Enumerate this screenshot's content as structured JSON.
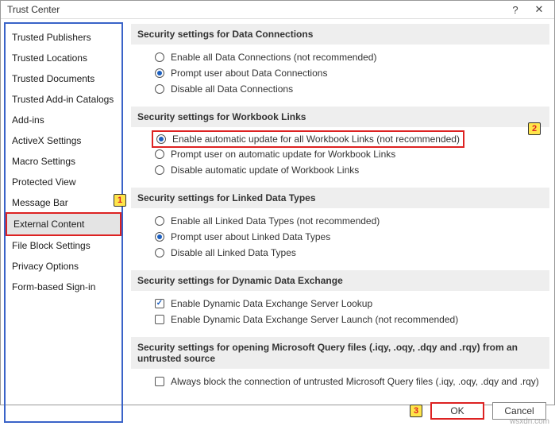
{
  "window": {
    "title": "Trust Center"
  },
  "sidebar": {
    "items": [
      {
        "label": "Trusted Publishers"
      },
      {
        "label": "Trusted Locations"
      },
      {
        "label": "Trusted Documents"
      },
      {
        "label": "Trusted Add-in Catalogs"
      },
      {
        "label": "Add-ins"
      },
      {
        "label": "ActiveX Settings"
      },
      {
        "label": "Macro Settings"
      },
      {
        "label": "Protected View"
      },
      {
        "label": "Message Bar"
      },
      {
        "label": "External Content"
      },
      {
        "label": "File Block Settings"
      },
      {
        "label": "Privacy Options"
      },
      {
        "label": "Form-based Sign-in"
      }
    ]
  },
  "groups": {
    "dataConnections": {
      "header": "Security settings for Data Connections",
      "opt1": "Enable all Data Connections (not recommended)",
      "opt2": "Prompt user about Data Connections",
      "opt3": "Disable all Data Connections"
    },
    "workbookLinks": {
      "header": "Security settings for Workbook Links",
      "opt1": "Enable automatic update for all Workbook Links (not recommended)",
      "opt2": "Prompt user on automatic update for Workbook Links",
      "opt3": "Disable automatic update of Workbook Links"
    },
    "linkedDataTypes": {
      "header": "Security settings for Linked Data Types",
      "opt1": "Enable all Linked Data Types (not recommended)",
      "opt2": "Prompt user about Linked Data Types",
      "opt3": "Disable all Linked Data Types"
    },
    "dde": {
      "header": "Security settings for Dynamic Data Exchange",
      "opt1": "Enable Dynamic Data Exchange Server Lookup",
      "opt2": "Enable Dynamic Data Exchange Server Launch (not recommended)"
    },
    "queryFiles": {
      "header": "Security settings for opening  Microsoft Query files (.iqy, .oqy, .dqy and .rqy) from an untrusted source",
      "opt1": "Always block the connection of untrusted Microsoft Query files (.iqy, .oqy, .dqy and .rqy)"
    }
  },
  "buttons": {
    "ok": "OK",
    "cancel": "Cancel"
  },
  "annotations": {
    "a1": "1",
    "a2": "2",
    "a3": "3"
  },
  "watermark": "wsxdn.com"
}
